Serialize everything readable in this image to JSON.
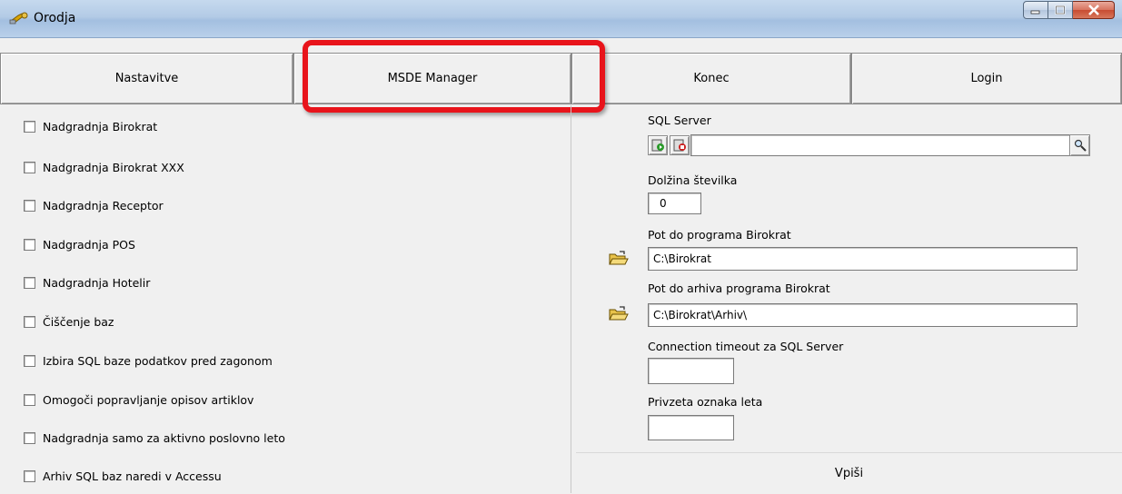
{
  "window": {
    "title": "Orodja"
  },
  "tabs": [
    {
      "id": "nastavitve",
      "label": "Nastavitve"
    },
    {
      "id": "msde",
      "label": "MSDE Manager"
    },
    {
      "id": "konec",
      "label": "Konec"
    },
    {
      "id": "login",
      "label": "Login"
    }
  ],
  "options": [
    {
      "label": "Nadgradnja Birokrat",
      "checked": false
    },
    {
      "label": "Nadgradnja Birokrat XXX",
      "checked": false
    },
    {
      "label": "Nadgradnja Receptor",
      "checked": false
    },
    {
      "label": "Nadgradnja POS",
      "checked": false
    },
    {
      "label": "Nadgradnja Hotelir",
      "checked": false
    },
    {
      "label": "Čiščenje baz",
      "checked": false
    },
    {
      "label": "Izbira SQL baze podatkov pred zagonom",
      "checked": false
    },
    {
      "label": "Omogoči popravljanje opisov artiklov",
      "checked": false
    },
    {
      "label": "Nadgradnja samo za aktivno poslovno leto",
      "checked": false
    },
    {
      "label": "Arhiv SQL baz naredi v Accessu",
      "checked": false
    }
  ],
  "settings": {
    "sql_server_label": "SQL Server",
    "sql_server_value": "",
    "length_label": "Dolžina številka",
    "length_value": "0",
    "program_path_label": "Pot do programa Birokrat",
    "program_path_value": "C:\\Birokrat",
    "archive_path_label": "Pot do arhiva programa Birokrat",
    "archive_path_value": "C:\\Birokrat\\Arhiv\\",
    "timeout_label": "Connection  timeout za SQL Server",
    "timeout_value": "",
    "year_label": "Privzeta oznaka leta",
    "year_value": "",
    "submit_label": "Vpiši"
  },
  "colors": {
    "highlight": "#e8141b",
    "titlebar": "#b3cbe6"
  }
}
